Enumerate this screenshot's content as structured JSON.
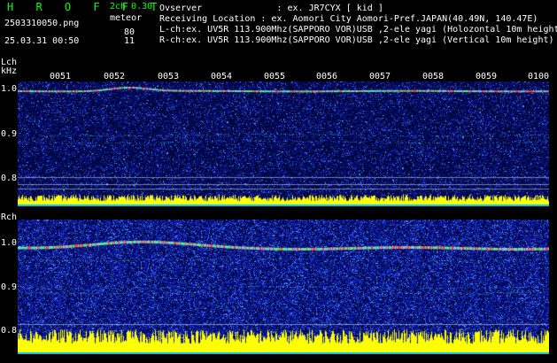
{
  "header": {
    "app_title": "H R O F F T",
    "file_name": "2503310050.png",
    "datetime": "25.03.31 00:50",
    "mode": "2ch 0.30",
    "meteor_label": "meteor",
    "lch_count": "80",
    "rch_count": "11"
  },
  "info": {
    "observer": "Ovserver              : ex. JR7CYX [ kid ]",
    "location": "Receiving Location : ex. Aomori City Aomori-Pref.JAPAN(40.49N, 140.47E)",
    "lch": "L-ch:ex. UV5R 113.900Mhz(SAPPORO VOR)USB ,2-ele yagi (Holozontal 10m height",
    "rch": "R-ch:ex. UV5R 113.900Mhz(SAPPORO VOR)USB ,2-ele yagi (Vertical 10m height)"
  },
  "time_ticks": [
    "0051",
    "0052",
    "0053",
    "0054",
    "0055",
    "0056",
    "0057",
    "0058",
    "0059",
    "0100"
  ],
  "lch_panel": {
    "label": "Lch",
    "unit": "kHz",
    "y_labels": [
      "1.0",
      "0.9",
      "0.8"
    ]
  },
  "rch_panel": {
    "label": "Rch",
    "y_labels": [
      "1.0",
      "0.9",
      "0.8"
    ]
  }
}
